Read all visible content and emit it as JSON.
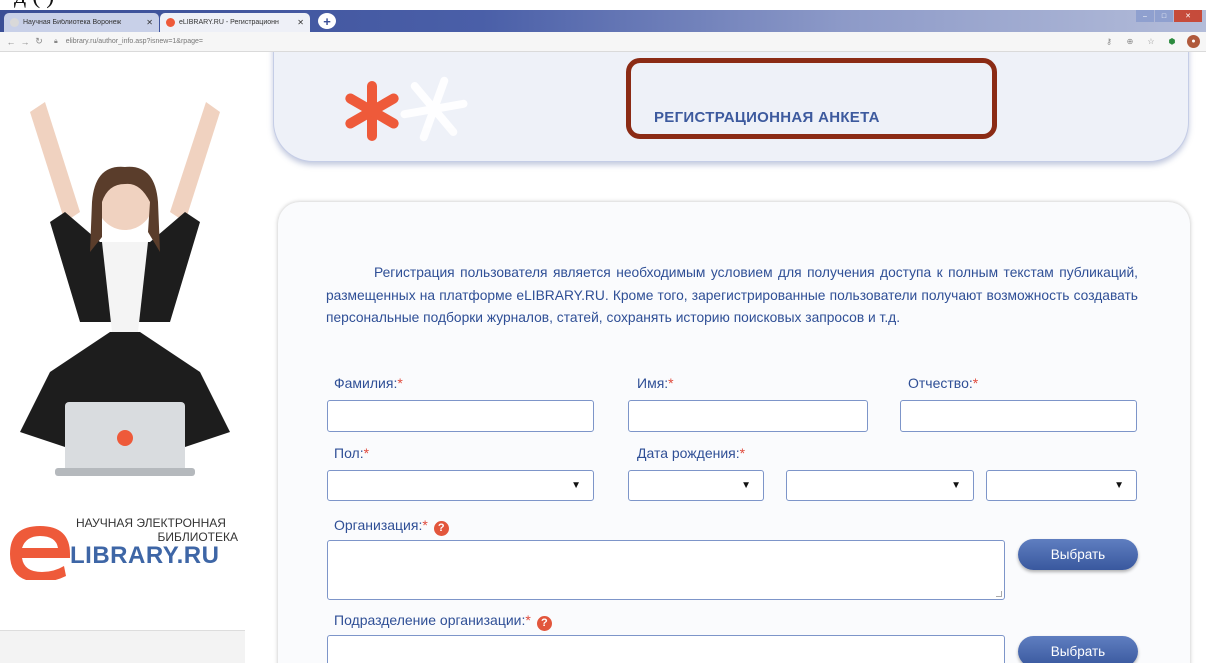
{
  "caption": {
    "partial_text": "д                         (      )"
  },
  "browser": {
    "tabs": [
      {
        "label": "Научная Библиотека Воронеж"
      },
      {
        "label": "eLIBRARY.RU - Регистрационн"
      }
    ],
    "new_tab": "+",
    "url": "elibrary.ru/author_info.asp?isnew=1&rpage="
  },
  "sidebar": {
    "logo_line1": "НАУЧНАЯ ЭЛЕКТРОННАЯ",
    "logo_line2": "БИБЛИОТЕКА",
    "logo_word": "LIBRARY.RU"
  },
  "header": {
    "title": "РЕГИСТРАЦИОННАЯ АНКЕТА"
  },
  "form": {
    "intro": "Регистрация пользователя является необходимым условием для получения доступа к полным текстам публикаций, размещенных на платформе eLIBRARY.RU. Кроме того, зарегистрированные пользователи получают возможность создавать персональные подборки журналов, статей, сохранять историю поисковых запросов и т.д.",
    "required_mark": "*",
    "help_mark": "?",
    "surname_label": "Фамилия:",
    "name_label": "Имя:",
    "patronymic_label": "Отчество:",
    "gender_label": "Пол:",
    "birthdate_label": "Дата рождения:",
    "organization_label": "Организация:",
    "department_label": "Подразделение организации:",
    "select_arrow": "▼",
    "choose_button": "Выбрать"
  },
  "colors": {
    "accent": "#2f4f96",
    "required": "#e04a3c",
    "highlight_frame": "#8b2b15",
    "logo_orange": "#ee5a3a"
  }
}
